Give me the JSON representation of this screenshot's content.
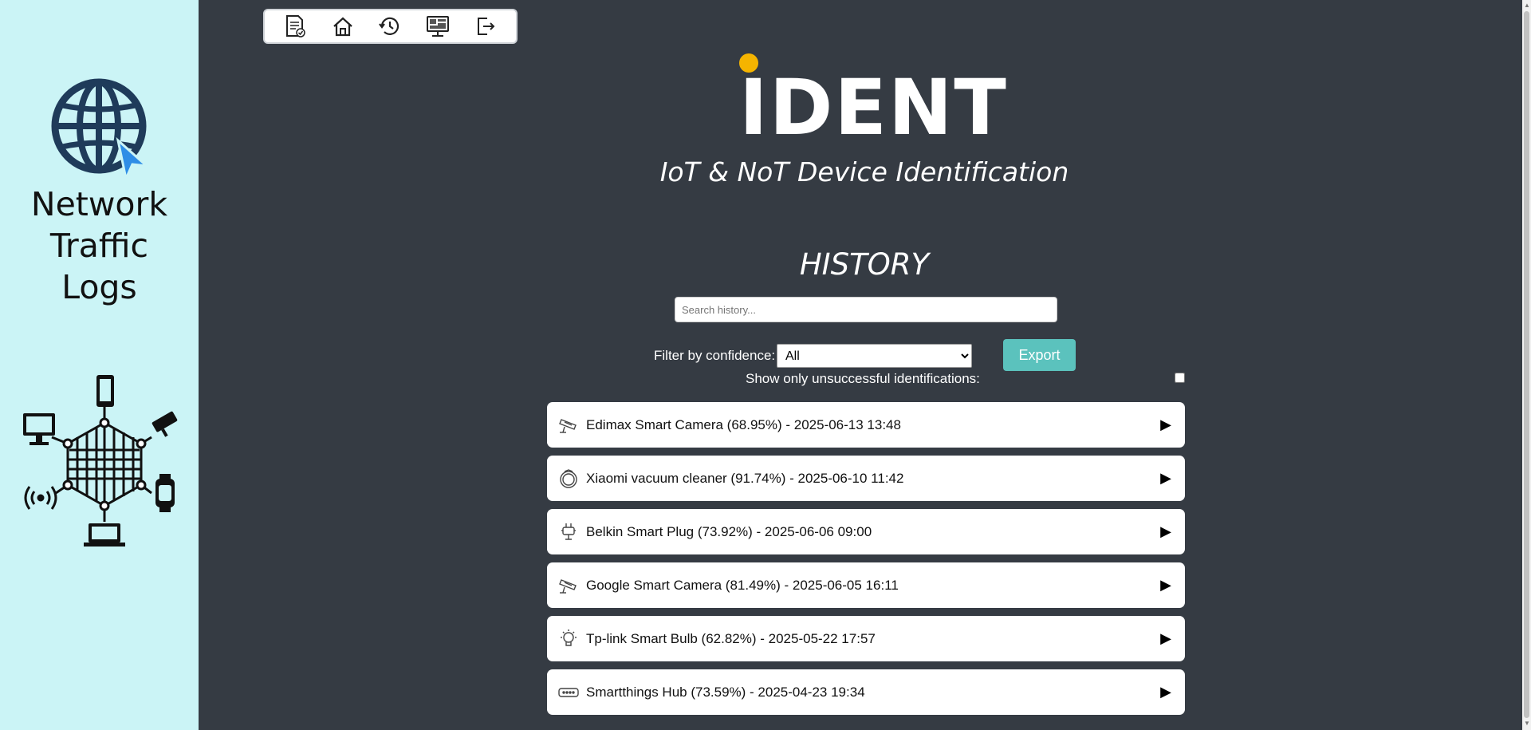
{
  "sidebar": {
    "title_lines": [
      "Network",
      "Traffic",
      "Logs"
    ]
  },
  "toolbar": {
    "buttons": [
      {
        "icon": "report-icon"
      },
      {
        "icon": "home-icon"
      },
      {
        "icon": "history-icon"
      },
      {
        "icon": "dashboard-icon"
      },
      {
        "icon": "logout-icon"
      }
    ]
  },
  "header": {
    "logo": "IDENT",
    "subtitle": "IoT & NoT Device Identification"
  },
  "history": {
    "title": "HISTORY",
    "search_placeholder": "Search history...",
    "filter_label": "Filter by confidence:",
    "filter_value": "All",
    "unsuccessful_label": "Show only unsuccessful identifications:",
    "export_label": "Export",
    "items": [
      {
        "icon": "camera-icon",
        "label": "Edimax Smart Camera (68.95%) - 2025-06-13 13:48"
      },
      {
        "icon": "vacuum-icon",
        "label": "Xiaomi vacuum cleaner (91.74%) - 2025-06-10 11:42"
      },
      {
        "icon": "plug-icon",
        "label": "Belkin Smart Plug (73.92%) - 2025-06-06 09:00"
      },
      {
        "icon": "camera-icon",
        "label": "Google Smart Camera (81.49%) - 2025-06-05 16:11"
      },
      {
        "icon": "bulb-icon",
        "label": "Tp-link Smart Bulb (62.82%) - 2025-05-22 17:57"
      },
      {
        "icon": "hub-icon",
        "label": "Smartthings Hub (73.59%) - 2025-04-23 19:34"
      }
    ]
  },
  "colors": {
    "background": "#353b43",
    "sidebar": "#cbf4f6",
    "accent": "#5bc2bd",
    "logo_dot": "#f5b400"
  }
}
